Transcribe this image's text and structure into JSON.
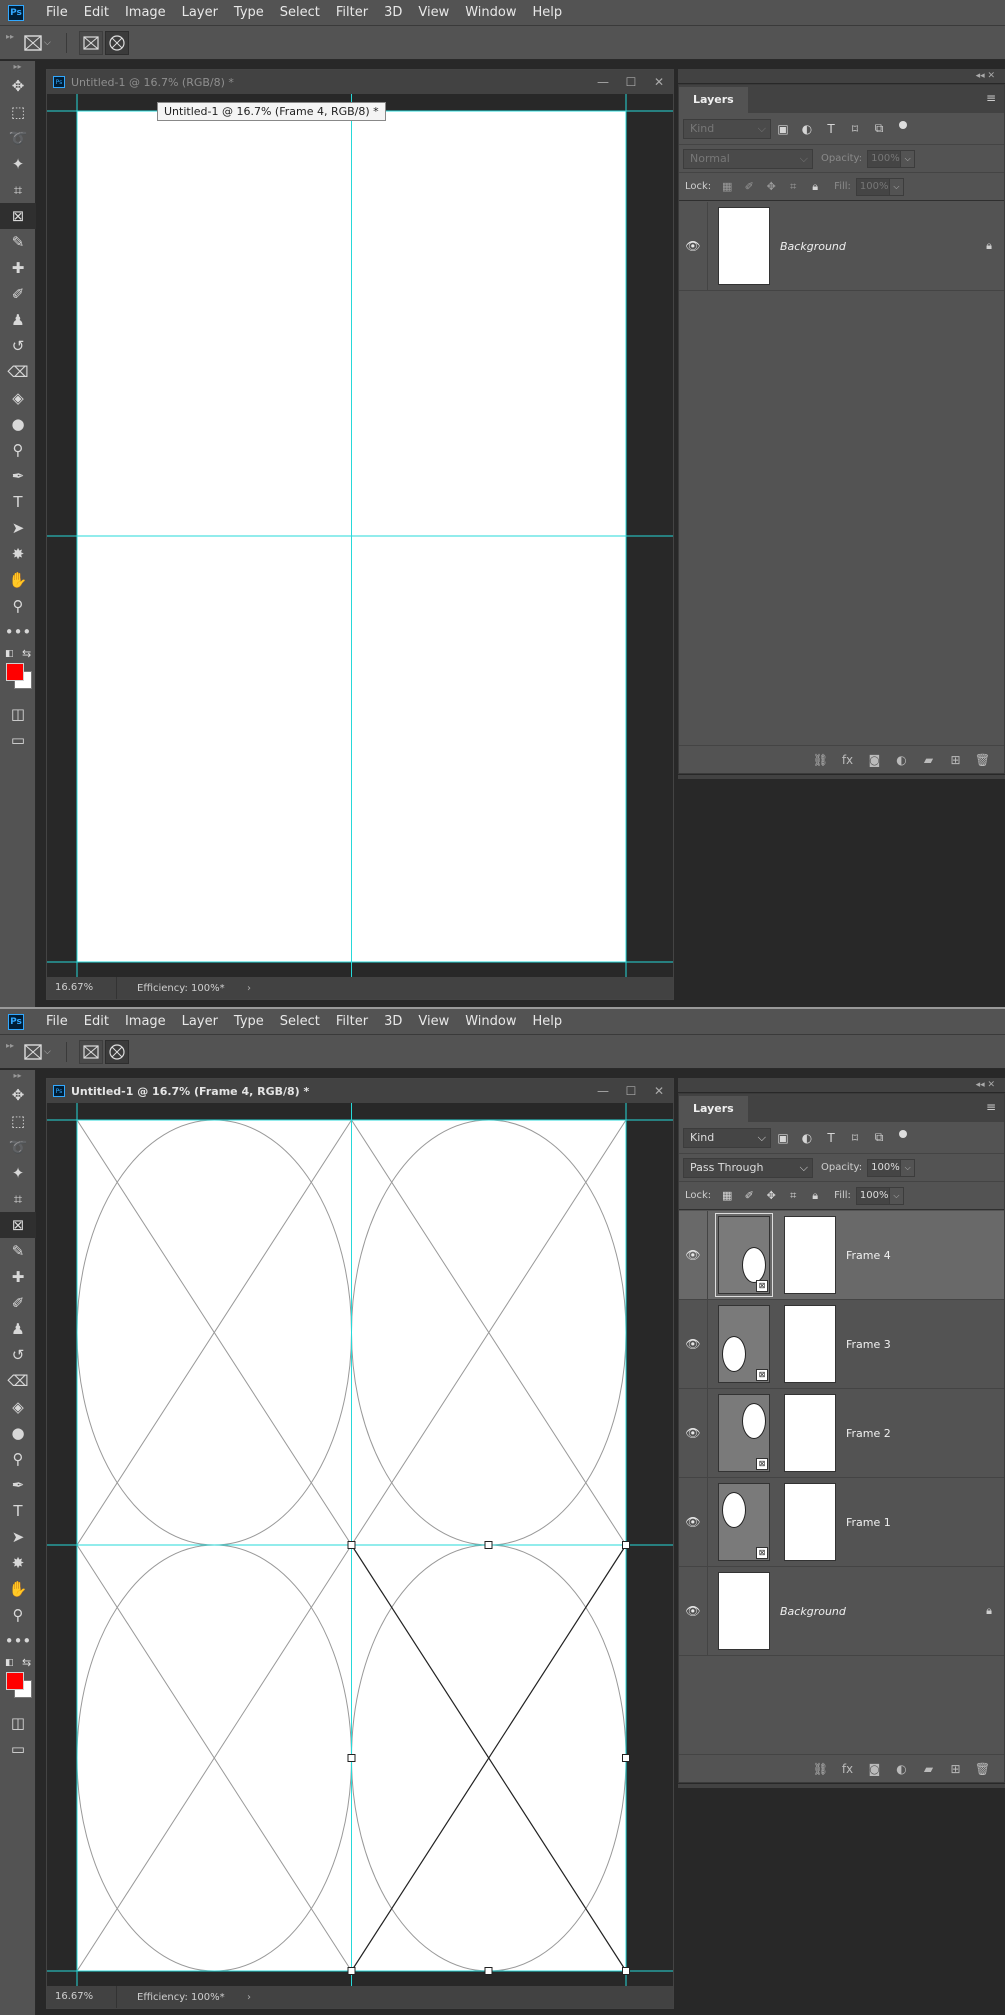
{
  "menu": [
    "File",
    "Edit",
    "Image",
    "Layer",
    "Type",
    "Select",
    "Filter",
    "3D",
    "View",
    "Window",
    "Help"
  ],
  "app_logo": "Ps",
  "icons": {
    "frame_tool": "frame-tool-icon",
    "rect_frame": "rectangular-frame-icon",
    "ellipse_frame": "elliptical-frame-icon",
    "eye": "eye-icon",
    "lock": "lock-icon"
  },
  "colors": {
    "foreground": "#ff0000",
    "background": "#ffffff",
    "guide": "#26d9d9",
    "accent": "#31a8ff"
  },
  "state1": {
    "doc_title": "Untitled-1 @ 16.7% (RGB/8) *",
    "tooltip": "Untitled-1 @ 16.7% (Frame 4, RGB/8) *",
    "zoom": "16.67%",
    "efficiency": "Efficiency: 100%*",
    "layers_tab": "Layers",
    "filter_kind": "Kind",
    "blend_mode": "Normal",
    "opacity_label": "Opacity:",
    "opacity": "100%",
    "lock_label": "Lock:",
    "fill_label": "Fill:",
    "fill": "100%",
    "layers": [
      {
        "name": "Background",
        "type": "background"
      }
    ]
  },
  "state2": {
    "doc_title": "Untitled-1 @ 16.7% (Frame 4, RGB/8) *",
    "zoom": "16.67%",
    "efficiency": "Efficiency: 100%*",
    "layers_tab": "Layers",
    "filter_kind": "Kind",
    "blend_mode": "Pass Through",
    "opacity_label": "Opacity:",
    "opacity": "100%",
    "lock_label": "Lock:",
    "fill_label": "Fill:",
    "fill": "100%",
    "layers": [
      {
        "name": "Frame 4",
        "type": "frame",
        "oval": "bottom-right",
        "selected": true
      },
      {
        "name": "Frame 3",
        "type": "frame",
        "oval": "bottom-left"
      },
      {
        "name": "Frame 2",
        "type": "frame",
        "oval": "top-right"
      },
      {
        "name": "Frame 1",
        "type": "frame",
        "oval": "top-left"
      },
      {
        "name": "Background",
        "type": "background"
      }
    ]
  }
}
